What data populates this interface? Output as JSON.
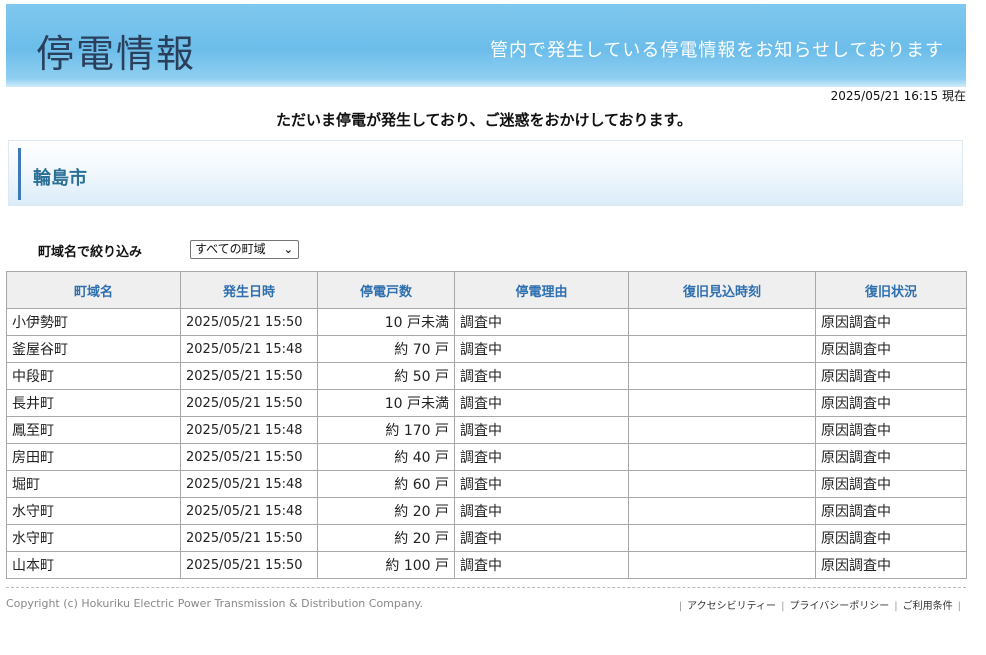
{
  "header": {
    "title": "停電情報",
    "tagline": "管内で発生している停電情報をお知らせしております"
  },
  "timestamp": "2025/05/21 16:15 現在",
  "notice": "ただいま停電が発生しており、ご迷惑をおかけしております。",
  "city": "輪島市",
  "filter": {
    "label": "町域名で絞り込み",
    "selected": "すべての町域"
  },
  "table": {
    "headers": [
      "町域名",
      "発生日時",
      "停電戸数",
      "停電理由",
      "復旧見込時刻",
      "復旧状況"
    ],
    "rows": [
      [
        "小伊勢町",
        "2025/05/21 15:50",
        "10 戸未満",
        "調査中",
        "",
        "原因調査中"
      ],
      [
        "釜屋谷町",
        "2025/05/21 15:48",
        "約 70 戸",
        "調査中",
        "",
        "原因調査中"
      ],
      [
        "中段町",
        "2025/05/21 15:50",
        "約 50 戸",
        "調査中",
        "",
        "原因調査中"
      ],
      [
        "長井町",
        "2025/05/21 15:50",
        "10 戸未満",
        "調査中",
        "",
        "原因調査中"
      ],
      [
        "鳳至町",
        "2025/05/21 15:48",
        "約 170 戸",
        "調査中",
        "",
        "原因調査中"
      ],
      [
        "房田町",
        "2025/05/21 15:50",
        "約 40 戸",
        "調査中",
        "",
        "原因調査中"
      ],
      [
        "堀町",
        "2025/05/21 15:48",
        "約 60 戸",
        "調査中",
        "",
        "原因調査中"
      ],
      [
        "水守町",
        "2025/05/21 15:48",
        "約 20 戸",
        "調査中",
        "",
        "原因調査中"
      ],
      [
        "水守町",
        "2025/05/21 15:50",
        "約 20 戸",
        "調査中",
        "",
        "原因調査中"
      ],
      [
        "山本町",
        "2025/05/21 15:50",
        "約 100 戸",
        "調査中",
        "",
        "原因調査中"
      ]
    ]
  },
  "footer": {
    "copyright": "Copyright (c) Hokuriku Electric Power Transmission & Distribution Company.",
    "links": [
      "アクセシビリティー",
      "プライバシーポリシー",
      "ご利用条件"
    ]
  },
  "colors": {
    "banner": "#6cbdea",
    "header_text": "#2e6fb0",
    "city_bar": "#3c79b5"
  }
}
